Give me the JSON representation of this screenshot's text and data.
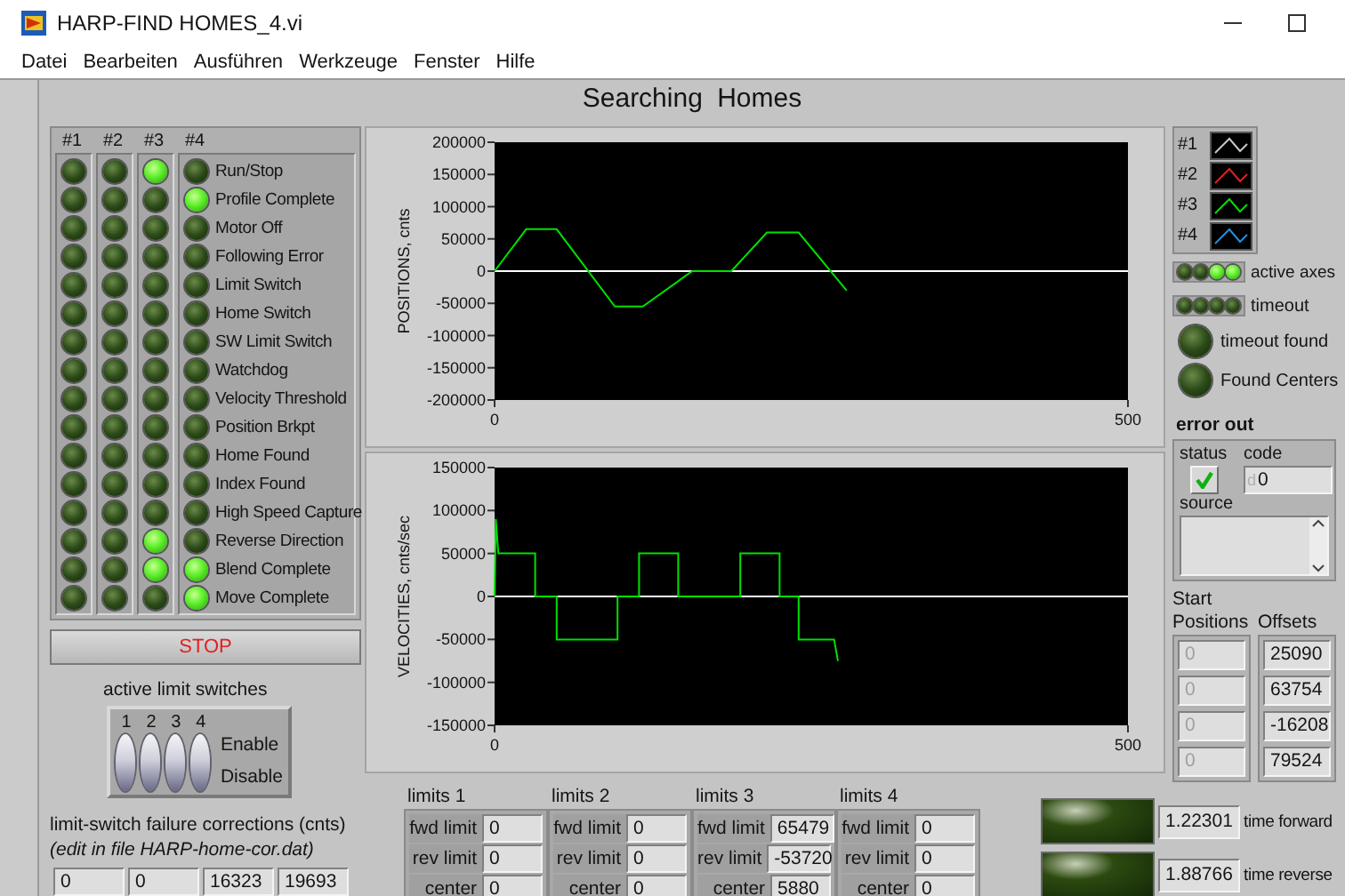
{
  "window": {
    "title": "HARP-FIND HOMES_4.vi"
  },
  "menu": [
    "Datei",
    "Bearbeiten",
    "Ausführen",
    "Werkzeuge",
    "Fenster",
    "Hilfe"
  ],
  "panel_title": "Searching Homes",
  "status_leds": {
    "columns": [
      "#1",
      "#2",
      "#3",
      "#4"
    ],
    "rows": [
      {
        "label": "Run/Stop",
        "on": [
          false,
          false,
          true,
          false
        ]
      },
      {
        "label": "Profile Complete",
        "on": [
          false,
          false,
          false,
          true
        ]
      },
      {
        "label": "Motor Off",
        "on": [
          false,
          false,
          false,
          false
        ]
      },
      {
        "label": "Following Error",
        "on": [
          false,
          false,
          false,
          false
        ]
      },
      {
        "label": "Limit Switch",
        "on": [
          false,
          false,
          false,
          false
        ]
      },
      {
        "label": "Home Switch",
        "on": [
          false,
          false,
          false,
          false
        ]
      },
      {
        "label": "SW Limit Switch",
        "on": [
          false,
          false,
          false,
          false
        ]
      },
      {
        "label": "Watchdog",
        "on": [
          false,
          false,
          false,
          false
        ]
      },
      {
        "label": "Velocity Threshold",
        "on": [
          false,
          false,
          false,
          false
        ]
      },
      {
        "label": "Position Brkpt",
        "on": [
          false,
          false,
          false,
          false
        ]
      },
      {
        "label": "Home Found",
        "on": [
          false,
          false,
          false,
          false
        ]
      },
      {
        "label": "Index Found",
        "on": [
          false,
          false,
          false,
          false
        ]
      },
      {
        "label": "High Speed Capture",
        "on": [
          false,
          false,
          false,
          false
        ]
      },
      {
        "label": "Reverse Direction",
        "on": [
          false,
          false,
          true,
          false
        ]
      },
      {
        "label": "Blend Complete",
        "on": [
          false,
          false,
          true,
          true
        ]
      },
      {
        "label": "Move Complete",
        "on": [
          false,
          false,
          false,
          true
        ]
      }
    ]
  },
  "stop_button": {
    "label": "STOP"
  },
  "limit_switches": {
    "title": "active limit switches",
    "switches": [
      {
        "number": "1",
        "enabled": true
      },
      {
        "number": "2",
        "enabled": true
      },
      {
        "number": "3",
        "enabled": true
      },
      {
        "number": "4",
        "enabled": true
      }
    ],
    "enable_label": "Enable",
    "disable_label": "Disable"
  },
  "corrections": {
    "title": "limit-switch failure corrections (cnts)",
    "note": "(edit in file HARP-home-cor.dat)",
    "values": [
      "0",
      "0",
      "16323",
      "19693"
    ]
  },
  "position_chart": {
    "chart_data": {
      "type": "line",
      "ylabel": "POSITIONS, cnts",
      "xlim": [
        0,
        500
      ],
      "ylim": [
        -200000,
        200000
      ],
      "xticks": [
        0,
        500
      ],
      "yticks": [
        -200000,
        -150000,
        -100000,
        -50000,
        0,
        50000,
        100000,
        150000,
        200000
      ],
      "x": [
        0,
        25,
        49,
        95,
        117,
        156,
        187,
        215,
        240,
        278,
        500
      ],
      "series": [
        {
          "color": "#ffffff",
          "values": [
            0,
            0,
            0,
            0,
            0,
            0,
            0,
            0,
            0,
            0,
            0
          ]
        },
        {
          "color": "#00e000",
          "values": [
            0,
            65000,
            65000,
            -55000,
            -55000,
            0,
            0,
            60000,
            60000,
            -30000,
            null
          ]
        }
      ]
    }
  },
  "velocity_chart": {
    "chart_data": {
      "type": "line",
      "ylabel": "VELOCITIES, cnts/sec",
      "xlim": [
        0,
        500
      ],
      "ylim": [
        -150000,
        150000
      ],
      "xticks": [
        0,
        500
      ],
      "yticks": [
        -150000,
        -100000,
        -50000,
        0,
        50000,
        100000,
        150000
      ],
      "x": [
        0,
        1,
        3,
        32,
        32,
        49,
        49,
        97,
        97,
        114,
        114,
        145,
        145,
        194,
        194,
        225,
        225,
        240,
        240,
        268,
        271,
        500
      ],
      "series": [
        {
          "color": "#ffffff",
          "values": [
            0,
            0,
            0,
            0,
            0,
            0,
            0,
            0,
            0,
            0,
            0,
            0,
            0,
            0,
            0,
            0,
            0,
            0,
            0,
            0,
            0,
            0
          ]
        },
        {
          "color": "#00e000",
          "values": [
            0,
            90000,
            50000,
            50000,
            0,
            0,
            -50000,
            -50000,
            0,
            0,
            50000,
            50000,
            0,
            0,
            50000,
            50000,
            0,
            0,
            -50000,
            -50000,
            -75000,
            null
          ]
        }
      ]
    }
  },
  "legend": [
    {
      "label": "#1",
      "color": "#c8c8c8"
    },
    {
      "label": "#2",
      "color": "#e02020"
    },
    {
      "label": "#3",
      "color": "#00e000"
    },
    {
      "label": "#4",
      "color": "#2090e0"
    }
  ],
  "active_axes": {
    "label": "active axes",
    "leds": [
      false,
      false,
      true,
      true
    ]
  },
  "timeout": {
    "label": "timeout",
    "leds": [
      false,
      false,
      false,
      false
    ]
  },
  "timeout_found": {
    "label": "timeout found",
    "on": false
  },
  "found_centers": {
    "label": "Found Centers",
    "on": false
  },
  "error_out": {
    "title": "error out",
    "status_label": "status",
    "status": false,
    "code_label": "code",
    "radix": "d",
    "code": "0",
    "source_label": "source"
  },
  "start_positions": {
    "title": "Start Positions",
    "disabled": true,
    "values": [
      "0",
      "0",
      "0",
      "0"
    ]
  },
  "offsets": {
    "title": "Offsets",
    "values": [
      "25090",
      "63754",
      "-16208",
      "79524"
    ]
  },
  "limits": [
    {
      "title": "limits 1",
      "fwd_label": "fwd limit",
      "fwd": "0",
      "rev_label": "rev limit",
      "rev": "0",
      "center_label": "center",
      "center": "0"
    },
    {
      "title": "limits 2",
      "fwd_label": "fwd limit",
      "fwd": "0",
      "rev_label": "rev limit",
      "rev": "0",
      "center_label": "center",
      "center": "0"
    },
    {
      "title": "limits 3",
      "fwd_label": "fwd limit",
      "fwd": "65479",
      "rev_label": "rev limit",
      "rev": "-53720",
      "center_label": "center",
      "center": "5880"
    },
    {
      "title": "limits 4",
      "fwd_label": "fwd limit",
      "fwd": "0",
      "rev_label": "rev limit",
      "rev": "0",
      "center_label": "center",
      "center": "0"
    }
  ],
  "timers": [
    {
      "on": false,
      "value": "1.22301",
      "label": "time forward"
    },
    {
      "on": false,
      "value": "1.88766",
      "label": "time reverse"
    }
  ]
}
